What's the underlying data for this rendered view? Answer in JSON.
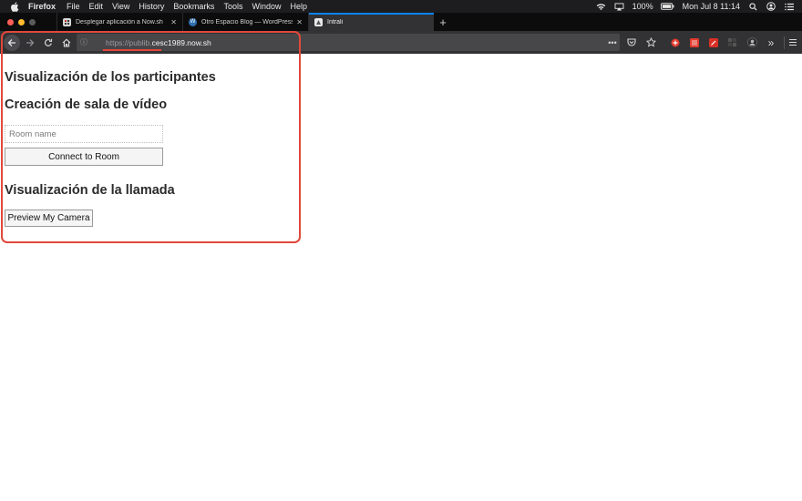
{
  "menubar": {
    "app_name": "Firefox",
    "items": [
      "File",
      "Edit",
      "View",
      "History",
      "Bookmarks",
      "Tools",
      "Window",
      "Help"
    ],
    "battery": "100%",
    "clock": "Mon Jul 8  11:14"
  },
  "tabs": [
    {
      "title": "Desplegar aplicación a Now.sh",
      "active": false
    },
    {
      "title": "Otro Espacio Blog — WordPress",
      "active": false
    },
    {
      "title": "Intrali",
      "active": true
    }
  ],
  "toolbar": {
    "url_protocol": "https://publib.",
    "url_host": "cesc1989.now.sh"
  },
  "page": {
    "heading_participants": "Visualización de los participantes",
    "heading_room": "Creación de sala de vídeo",
    "room_input_placeholder": "Room name",
    "connect_button": "Connect to Room",
    "heading_call": "Visualización de la llamada",
    "preview_button": "Preview My Camera"
  },
  "colors": {
    "highlight": "#e0483b",
    "active_tab_accent": "#0a84ff"
  }
}
